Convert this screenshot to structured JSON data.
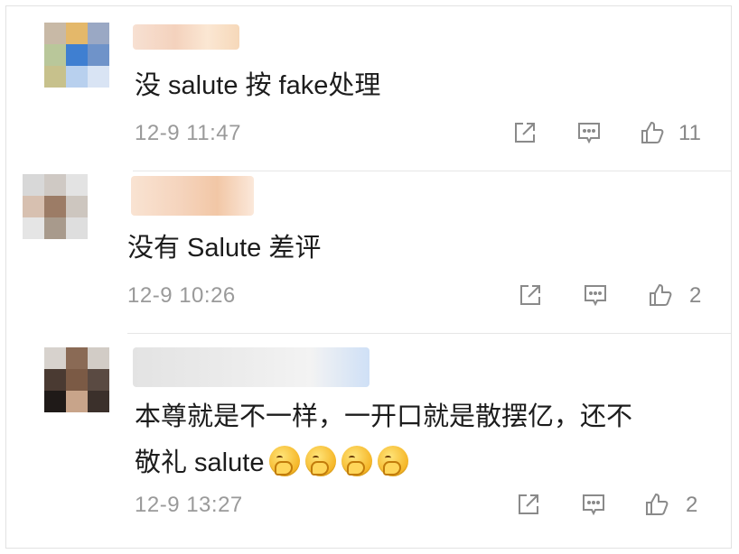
{
  "comments": [
    {
      "text": "没 salute 按 fake处理",
      "time": "12-9 11:47",
      "likes": "11"
    },
    {
      "text": "没有 Salute 差评",
      "time": "12-9 10:26",
      "likes": "2"
    },
    {
      "text_line1": "本尊就是不一样，一开口就是散摆亿，还不",
      "text_line2": "敬礼 salute",
      "emoji_count": 4,
      "emoji_icon": "smirk-salute-emoji",
      "time": "12-9 13:27",
      "likes": "2"
    }
  ],
  "icons": {
    "share": "share-icon",
    "reply": "comment-icon",
    "like": "thumbs-up-icon"
  },
  "colors": {
    "text": "#1c1c1c",
    "meta": "#9a9a9a",
    "icon": "#8a8a8a"
  }
}
